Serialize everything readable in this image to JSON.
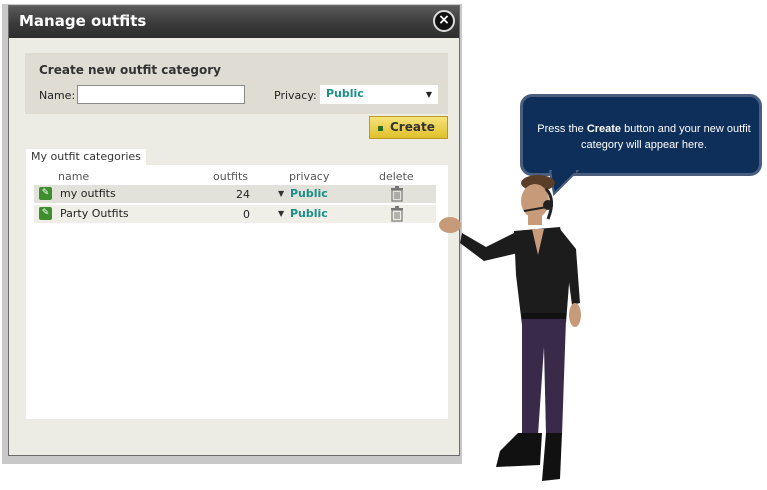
{
  "dialog": {
    "title": "Manage outfits",
    "close_label": "×"
  },
  "create_section": {
    "heading": "Create new outfit category",
    "name_label": "Name:",
    "name_value": "",
    "privacy_label": "Privacy:",
    "privacy_value": "Public",
    "create_button_label": "Create"
  },
  "categories": {
    "tab_label": "My outfit categories",
    "columns": {
      "name": "name",
      "outfits": "outfits",
      "privacy": "privacy",
      "delete": "delete"
    },
    "rows": [
      {
        "name": "my outfits",
        "outfits": "24",
        "privacy": "Public"
      },
      {
        "name": "Party Outfits",
        "outfits": "0",
        "privacy": "Public"
      }
    ]
  },
  "tooltip": {
    "prefix": "Press the ",
    "emphasis": "Create",
    "suffix": " button and your new outfit category will appear here."
  },
  "colors": {
    "privacy_text": "#1a8f8a",
    "create_button": "#f0d24a",
    "bubble": "#0e2f5a",
    "edit_icon": "#3e8e2e"
  },
  "icons": {
    "close": "close-icon",
    "edit": "pencil-icon",
    "delete": "trash-icon",
    "dropdown": "chevron-down-icon"
  }
}
